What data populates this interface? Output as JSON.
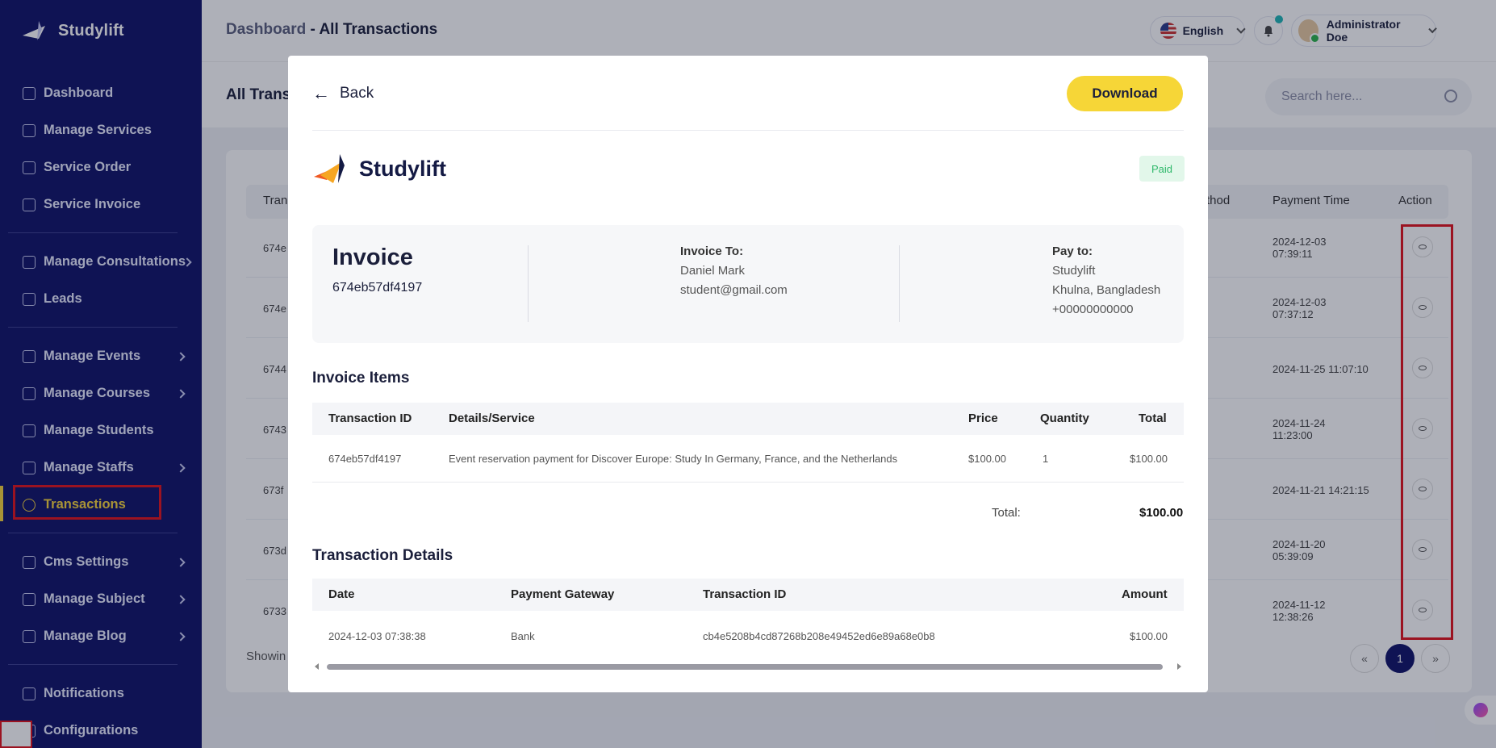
{
  "sidebar": {
    "brand": "Studylift",
    "items": [
      {
        "label": "Dashboard",
        "icon": "grid-icon"
      },
      {
        "label": "Manage Services",
        "icon": "services-icon"
      },
      {
        "label": "Service Order",
        "icon": "order-icon"
      },
      {
        "label": "Service Invoice",
        "icon": "invoice-icon"
      },
      {
        "label": "Manage Consultations",
        "icon": "consultation-icon"
      },
      {
        "label": "Leads",
        "icon": "leads-icon"
      },
      {
        "label": "Manage Events",
        "icon": "calendar-icon"
      },
      {
        "label": "Manage Courses",
        "icon": "course-icon"
      },
      {
        "label": "Manage Students",
        "icon": "students-icon"
      },
      {
        "label": "Manage Staffs",
        "icon": "staff-icon"
      },
      {
        "label": "Transactions",
        "icon": "transactions-icon"
      },
      {
        "label": "Cms Settings",
        "icon": "settings-icon"
      },
      {
        "label": "Manage Subject",
        "icon": "book-icon"
      },
      {
        "label": "Manage Blog",
        "icon": "blog-icon"
      },
      {
        "label": "Notifications",
        "icon": "bell-icon"
      },
      {
        "label": "Configurations",
        "icon": "config-icon"
      }
    ]
  },
  "header": {
    "crumb_root": "Dashboard",
    "crumb_sep": "-",
    "crumb_current": "All Transactions",
    "language": "English",
    "user_name": "Administrator Doe"
  },
  "page": {
    "title": "All Trans",
    "search_placeholder": "Search here...",
    "columns": [
      "Tran",
      "thod",
      "Payment Time",
      "Action"
    ],
    "rows": [
      {
        "id": "674e",
        "time": "2024-12-03\n07:39:11"
      },
      {
        "id": "674e",
        "time": "2024-12-03\n07:37:12"
      },
      {
        "id": "6744",
        "time": "2024-11-25 11:07:10"
      },
      {
        "id": "6743",
        "time": "2024-11-24\n11:23:00"
      },
      {
        "id": "673f",
        "time": "2024-11-21 14:21:15"
      },
      {
        "id": "673d",
        "time": "2024-11-20\n05:39:09"
      },
      {
        "id": "6733",
        "time": "2024-11-12\n12:38:26"
      }
    ],
    "showing": "Showin",
    "pager": {
      "prev": "«",
      "current": "1",
      "next": "»"
    }
  },
  "modal": {
    "back_label": "Back",
    "download_label": "Download",
    "brand": "Studylift",
    "status": "Paid",
    "invoice_title": "Invoice",
    "invoice_no": "674eb57df4197",
    "invoice_to": {
      "heading": "Invoice To:",
      "name": "Daniel Mark",
      "email": "student@gmail.com"
    },
    "pay_to": {
      "heading": "Pay to:",
      "name": "Studylift",
      "address": "Khulna, Bangladesh",
      "phone": "+00000000000"
    },
    "items": {
      "title": "Invoice Items",
      "headers": {
        "id": "Transaction ID",
        "details": "Details/Service",
        "price": "Price",
        "qty": "Quantity",
        "total": "Total"
      },
      "row": {
        "id": "674eb57df4197",
        "details": "Event reservation payment for Discover Europe: Study In Germany, France, and the Netherlands",
        "price": "$100.00",
        "qty": "1",
        "total": "$100.00"
      },
      "total_label": "Total:",
      "total_value": "$100.00"
    },
    "transaction": {
      "title": "Transaction Details",
      "headers": {
        "date": "Date",
        "gateway": "Payment Gateway",
        "id": "Transaction ID",
        "amount": "Amount"
      },
      "row": {
        "date": "2024-12-03 07:38:38",
        "gateway": "Bank",
        "id": "cb4e5208b4cd87268b208e49452ed6e89a68e0b8",
        "amount": "$100.00"
      }
    }
  },
  "colors": {
    "sidebar": "#0f1268",
    "accent": "#f6d33a",
    "highlight": "#e3121b",
    "paid": "#2fb86b"
  }
}
